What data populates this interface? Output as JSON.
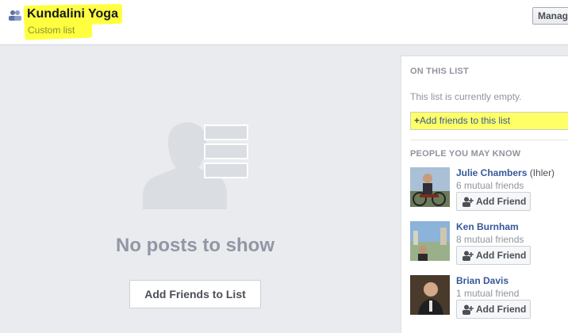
{
  "header": {
    "title": "Kundalini Yoga",
    "subtitle": "Custom list",
    "manage_label": "Manag",
    "list_icon": "friends-list-icon"
  },
  "main": {
    "empty_message": "No posts to show",
    "add_button_label": "Add Friends to List",
    "illustration_icon": "empty-feed-icon"
  },
  "rail": {
    "on_list_header": "ON THIS LIST",
    "empty_text": "This list is currently empty.",
    "add_to_list_plus": "+",
    "add_to_list_label": "Add friends to this list",
    "pymk_header": "PEOPLE YOU MAY KNOW",
    "add_friend_label": "Add Friend",
    "people": [
      {
        "name": "Julie Chambers",
        "alt_name": "(Ihler)",
        "mutual": "6 mutual friends"
      },
      {
        "name": "Ken Burnham",
        "alt_name": "",
        "mutual": "8 mutual friends"
      },
      {
        "name": "Brian Davis",
        "alt_name": "",
        "mutual": "1 mutual friend"
      }
    ]
  },
  "colors": {
    "highlight": "#ffff3f",
    "link": "#365899",
    "muted": "#90949c",
    "background": "#e9ebee"
  }
}
